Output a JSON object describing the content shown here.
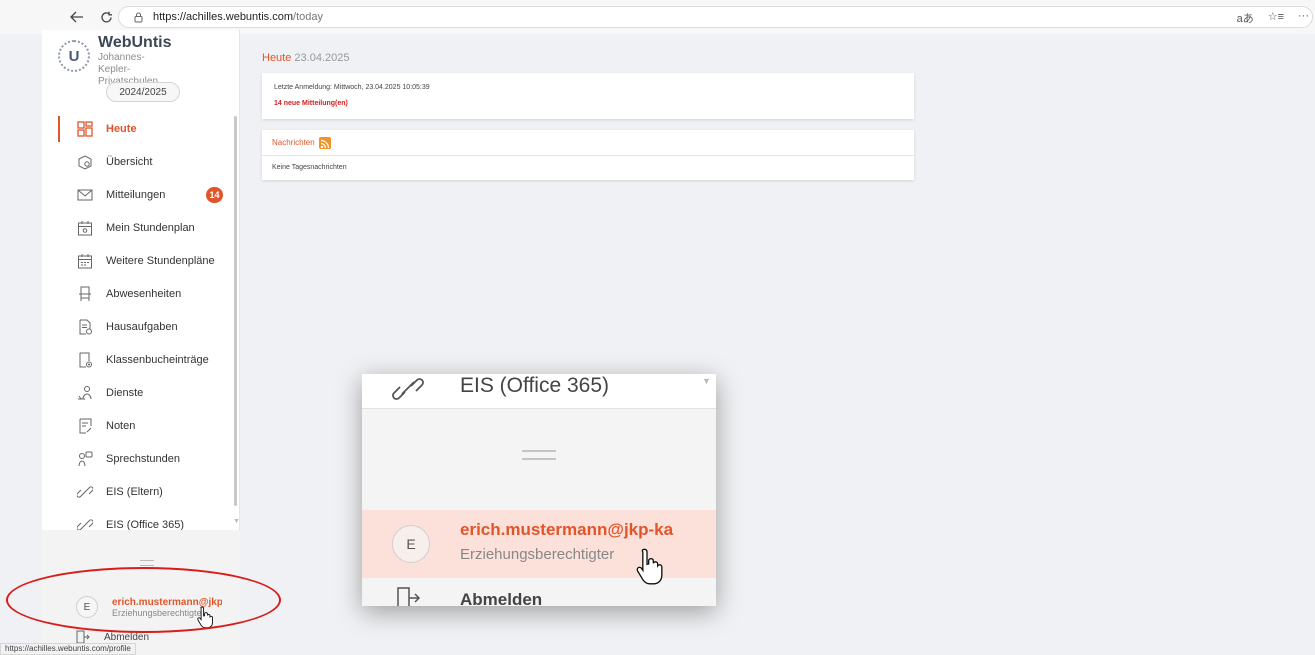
{
  "browser": {
    "url_host": "https://achilles.webuntis.com",
    "url_path": "/today",
    "reader_label": "aあ"
  },
  "sidebar": {
    "brand": "WebUntis",
    "school": "Johannes-Kepler-Privatschulen",
    "school_year": "2024/2025",
    "items": [
      {
        "label": "Heute",
        "icon": "dashboard-icon",
        "active": true
      },
      {
        "label": "Übersicht",
        "icon": "overview-icon"
      },
      {
        "label": "Mitteilungen",
        "icon": "mail-icon",
        "badge": "14"
      },
      {
        "label": "Mein Stundenplan",
        "icon": "calendar-icon"
      },
      {
        "label": "Weitere Stundenpläne",
        "icon": "calendar-grid-icon"
      },
      {
        "label": "Abwesenheiten",
        "icon": "chair-icon"
      },
      {
        "label": "Hausaufgaben",
        "icon": "homework-icon"
      },
      {
        "label": "Klassenbucheinträge",
        "icon": "classbook-icon"
      },
      {
        "label": "Dienste",
        "icon": "duties-icon"
      },
      {
        "label": "Noten",
        "icon": "grades-icon"
      },
      {
        "label": "Sprechstunden",
        "icon": "consultation-icon"
      },
      {
        "label": "EIS (Eltern)",
        "icon": "link-icon"
      },
      {
        "label": "EIS (Office 365)",
        "icon": "link-icon"
      }
    ],
    "profile": {
      "avatar_letter": "E",
      "email": "erich.mustermann@jkp-ka",
      "role": "Erziehungsberechtigter"
    },
    "logout_label": "Abmelden"
  },
  "status_bar_url": "https://achilles.webuntis.com/profile",
  "main": {
    "heading_title": "Heute",
    "heading_date": "23.04.2025",
    "last_login": "Letzte Anmeldung: Mittwoch, 23.04.2025 10:05:39",
    "new_messages": "14 neue Mitteilung(en)",
    "news_title": "Nachrichten",
    "no_news": "Keine Tagesnachrichten"
  },
  "zoom": {
    "top_label": "EIS (Office 365)",
    "avatar_letter": "E",
    "email": "erich.mustermann@jkp-ka",
    "role": "Erziehungsberechtigter",
    "logout_label": "Abmelden"
  },
  "colors": {
    "accent": "#e2552b",
    "highlight_ring": "#d91c1c"
  }
}
